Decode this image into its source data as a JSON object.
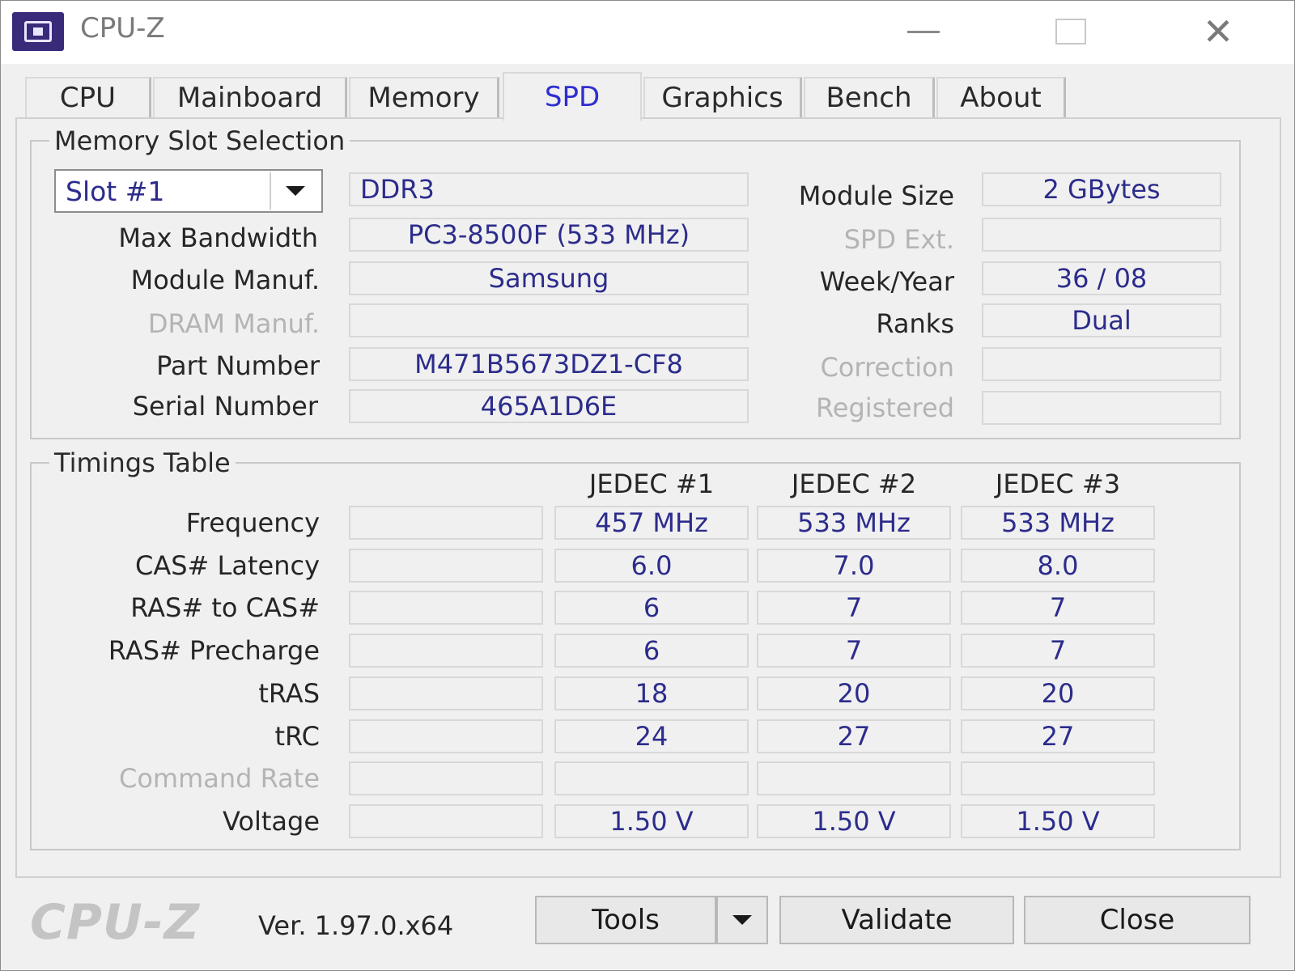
{
  "window": {
    "title": "CPU-Z",
    "icon": "cpu-z-app-icon"
  },
  "tabs": [
    {
      "label": "CPU",
      "active": false
    },
    {
      "label": "Mainboard",
      "active": false
    },
    {
      "label": "Memory",
      "active": false
    },
    {
      "label": "SPD",
      "active": true
    },
    {
      "label": "Graphics",
      "active": false
    },
    {
      "label": "Bench",
      "active": false
    },
    {
      "label": "About",
      "active": false
    }
  ],
  "slot_selection": {
    "legend": "Memory Slot Selection",
    "slot_value": "Slot #1",
    "memory_type": "DDR3",
    "max_bandwidth_label": "Max Bandwidth",
    "max_bandwidth": "PC3-8500F (533 MHz)",
    "module_manuf_label": "Module Manuf.",
    "module_manuf": "Samsung",
    "dram_manuf_label": "DRAM Manuf.",
    "dram_manuf": "",
    "part_number_label": "Part Number",
    "part_number": "M471B5673DZ1-CF8",
    "serial_number_label": "Serial Number",
    "serial_number": "465A1D6E",
    "module_size_label": "Module Size",
    "module_size": "2 GBytes",
    "spd_ext_label": "SPD Ext.",
    "spd_ext": "",
    "week_year_label": "Week/Year",
    "week_year": "36 / 08",
    "ranks_label": "Ranks",
    "ranks": "Dual",
    "correction_label": "Correction",
    "correction": "",
    "registered_label": "Registered",
    "registered": ""
  },
  "timings": {
    "legend": "Timings Table",
    "columns": [
      "JEDEC #1",
      "JEDEC #2",
      "JEDEC #3"
    ],
    "rows": [
      {
        "label": "Frequency",
        "dim": false,
        "values": [
          "",
          "457 MHz",
          "533 MHz",
          "533 MHz"
        ]
      },
      {
        "label": "CAS# Latency",
        "dim": false,
        "values": [
          "",
          "6.0",
          "7.0",
          "8.0"
        ]
      },
      {
        "label": "RAS# to CAS#",
        "dim": false,
        "values": [
          "",
          "6",
          "7",
          "7"
        ]
      },
      {
        "label": "RAS# Precharge",
        "dim": false,
        "values": [
          "",
          "6",
          "7",
          "7"
        ]
      },
      {
        "label": "tRAS",
        "dim": false,
        "values": [
          "",
          "18",
          "20",
          "20"
        ]
      },
      {
        "label": "tRC",
        "dim": false,
        "values": [
          "",
          "24",
          "27",
          "27"
        ]
      },
      {
        "label": "Command Rate",
        "dim": true,
        "values": [
          "",
          "",
          "",
          ""
        ]
      },
      {
        "label": "Voltage",
        "dim": false,
        "values": [
          "",
          "1.50 V",
          "1.50 V",
          "1.50 V"
        ]
      }
    ]
  },
  "footer": {
    "logo": "CPU-Z",
    "version": "Ver. 1.97.0.x64",
    "tools_label": "Tools",
    "validate_label": "Validate",
    "close_label": "Close"
  }
}
